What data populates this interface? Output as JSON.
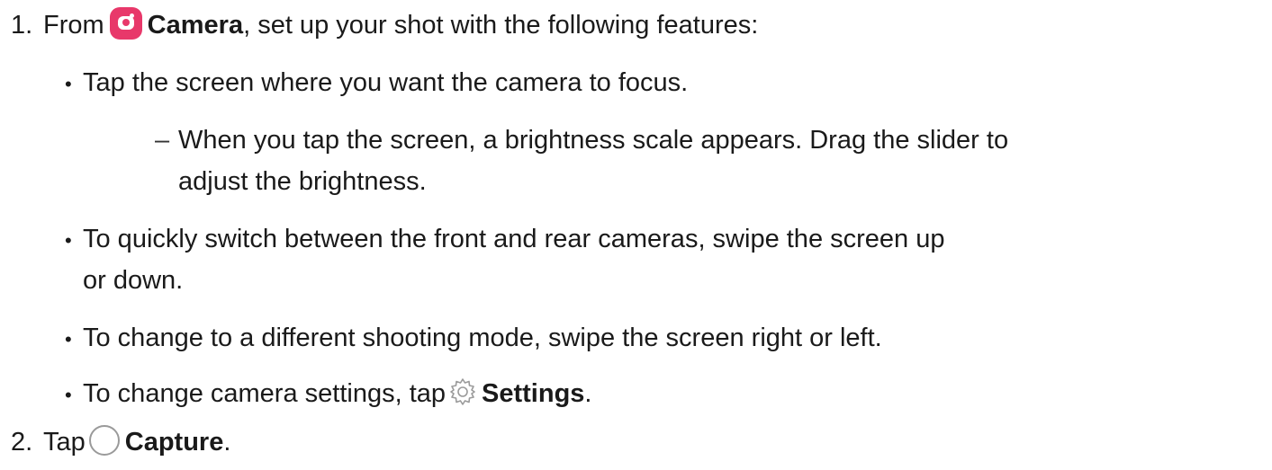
{
  "steps": [
    {
      "number": "1.",
      "text_before": "From",
      "app_name": "Camera",
      "app_icon": "camera-app-icon",
      "text_after": ", set up your shot with the following features:",
      "sub_items": [
        {
          "text": "Tap the screen where you want the camera to focus.",
          "details": [
            {
              "line1": "When you tap the screen, a brightness scale appears. Drag the slider to",
              "line2": "adjust the brightness."
            }
          ]
        },
        {
          "line1": "To quickly switch between the front and rear cameras, swipe the screen up",
          "line2": "or down."
        },
        {
          "text": "To change to a different shooting mode, swipe the screen right or left."
        },
        {
          "text_before": "To change camera settings, tap",
          "icon": "gear-icon",
          "label": "Settings",
          "text_after": "."
        }
      ]
    },
    {
      "number": "2.",
      "text_before": "Tap",
      "icon": "capture-button-icon",
      "label": "Capture",
      "text_after": "."
    }
  ],
  "symbols": {
    "bullet": "•",
    "dash": "–"
  },
  "colors": {
    "camera_icon_bg": "#e8386a",
    "text": "#1a1a1a",
    "icon_outline": "#9a9a9a"
  }
}
